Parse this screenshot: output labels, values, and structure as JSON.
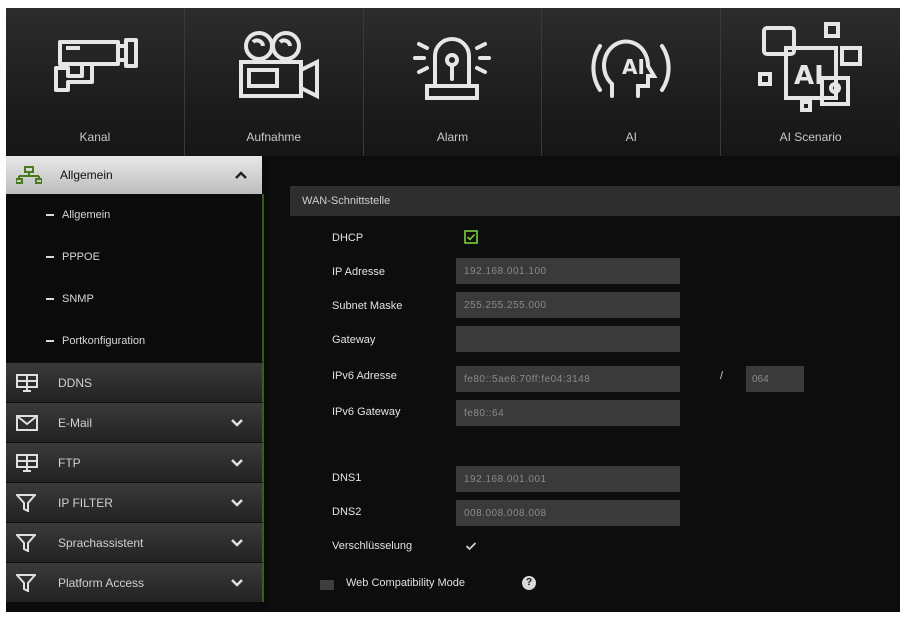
{
  "topnav": {
    "items": [
      {
        "label": "Kanal",
        "icon": "cctv-camera-icon"
      },
      {
        "label": "Aufnahme",
        "icon": "video-camera-icon"
      },
      {
        "label": "Alarm",
        "icon": "alarm-siren-icon"
      },
      {
        "label": "AI",
        "icon": "ai-head-icon"
      },
      {
        "label": "AI Scenario",
        "icon": "ai-scenario-icon"
      }
    ]
  },
  "sidebar": {
    "active_group": {
      "label": "Allgemein",
      "icon": "network-icon"
    },
    "subitems": [
      "Allgemein",
      "PPPOE",
      "SNMP",
      "Portkonfiguration"
    ],
    "items": [
      {
        "label": "DDNS",
        "icon": "ddns-icon",
        "expandable": false
      },
      {
        "label": "E-Mail",
        "icon": "mail-icon",
        "expandable": true
      },
      {
        "label": "FTP",
        "icon": "ftp-icon",
        "expandable": true
      },
      {
        "label": "IP FILTER",
        "icon": "filter-icon",
        "expandable": true
      },
      {
        "label": "Sprachassistent",
        "icon": "filter-icon",
        "expandable": true
      },
      {
        "label": "Platform Access",
        "icon": "filter-icon",
        "expandable": true
      }
    ]
  },
  "content": {
    "section_title": "WAN-Schnittstelle",
    "fields": {
      "dhcp": {
        "label": "DHCP",
        "checked": true
      },
      "ip": {
        "label": "IP Adresse",
        "value": "192.168.001.100"
      },
      "subnet": {
        "label": "Subnet Maske",
        "value": "255.255.255.000"
      },
      "gateway": {
        "label": "Gateway",
        "value": ""
      },
      "ipv6": {
        "label": "IPv6 Adresse",
        "value": "fe80::5ae6:70ff:fe04:3148",
        "prefix_sep": "/",
        "prefix": "064"
      },
      "ipv6gw": {
        "label": "IPv6 Gateway",
        "value": "fe80::64"
      },
      "dns1": {
        "label": "DNS1",
        "value": "192.168.001.001"
      },
      "dns2": {
        "label": "DNS2",
        "value": "008.008.008.008"
      },
      "encryption": {
        "label": "Verschlüsselung",
        "checked": true
      }
    },
    "web_compat": {
      "label": "Web Compatibility Mode",
      "help": "?"
    }
  },
  "colors": {
    "accent_green": "#4a7a1e",
    "check_green": "#7bd03a",
    "panel": "#2e2e2e",
    "input_bg": "#3a3a3a"
  }
}
